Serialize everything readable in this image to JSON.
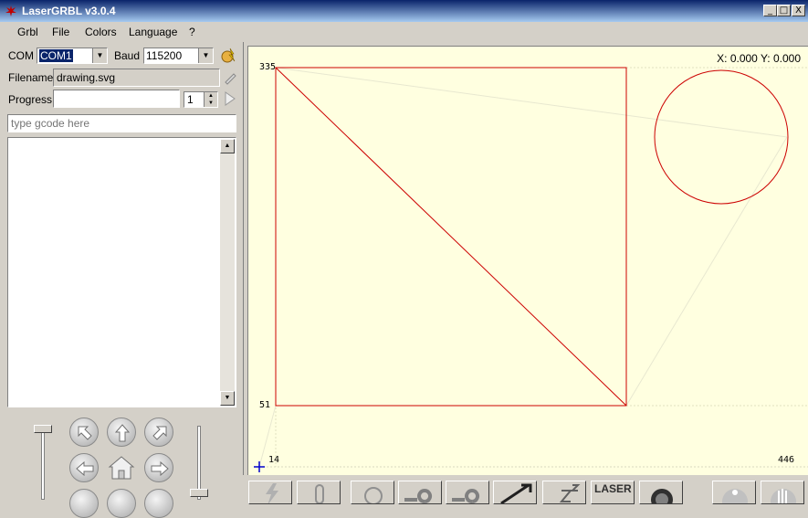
{
  "window": {
    "title": "LaserGRBL v3.0.4",
    "min": "_",
    "max": "□",
    "close": "X"
  },
  "menu": [
    "Grbl",
    "File",
    "Colors",
    "Language",
    "?"
  ],
  "connection": {
    "com_label": "COM",
    "com_value": "COM1",
    "baud_label": "Baud",
    "baud_value": "115200"
  },
  "file": {
    "filename_label": "Filename",
    "filename_value": "drawing.svg"
  },
  "progress": {
    "label": "Progress",
    "count": "1"
  },
  "gcode_input": {
    "placeholder": "type gcode here"
  },
  "canvas": {
    "position_readout": "X: 0.000 Y: 0.000",
    "y_top_label": "335",
    "y_bottom_label": "51",
    "x_left_label": "14",
    "x_right_label": "446"
  },
  "toolbar": {
    "laser_label": "LASER"
  },
  "colors": {
    "accent": "#0a246a",
    "path": "#cc0000",
    "canvas_bg": "#ffffe0",
    "panel": "#d4d0c8"
  }
}
